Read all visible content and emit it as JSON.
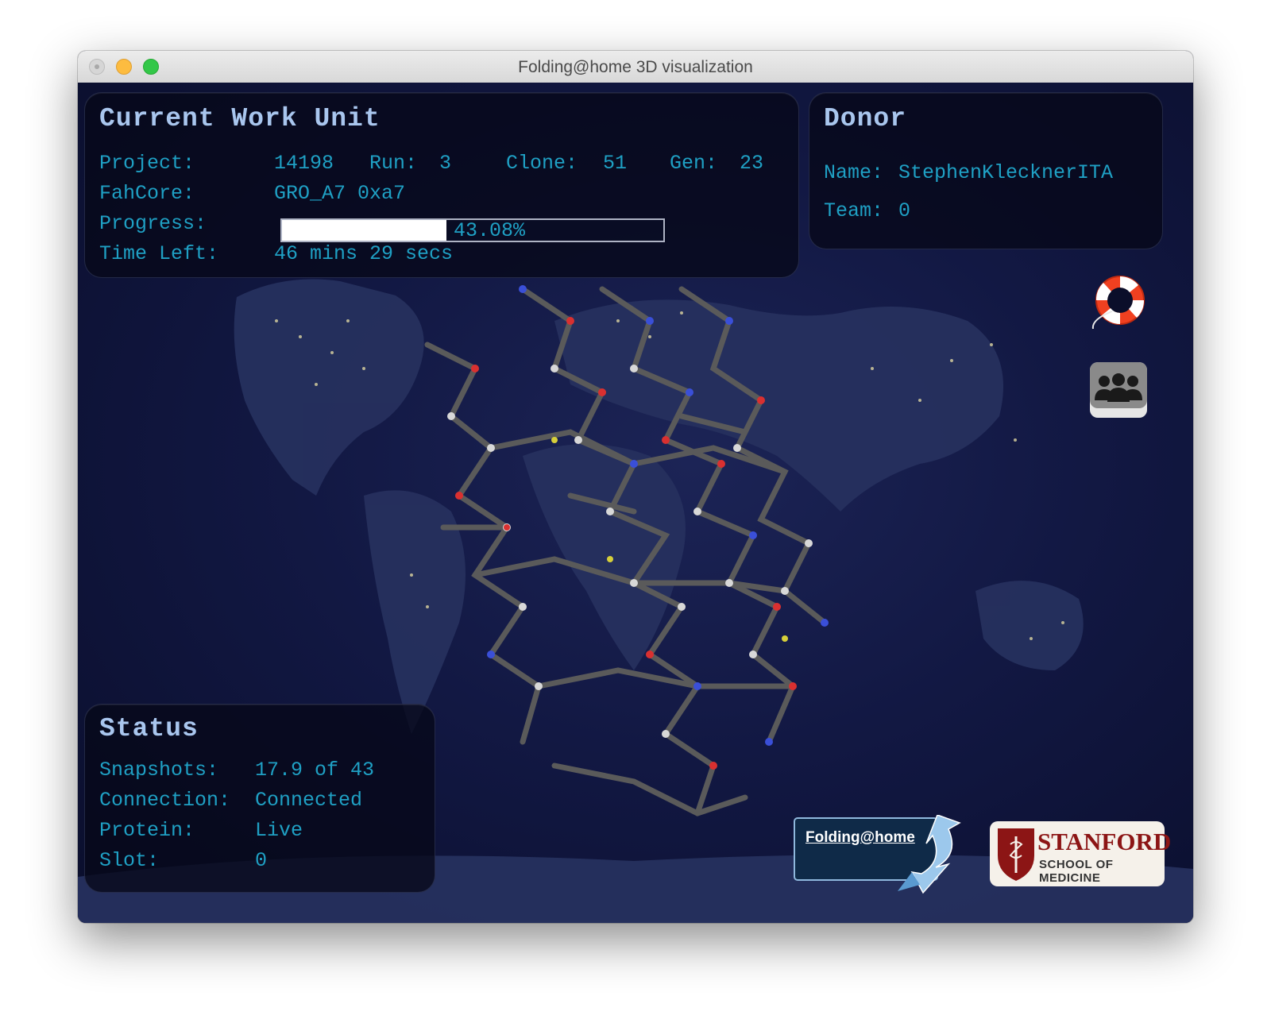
{
  "window": {
    "title": "Folding@home 3D visualization"
  },
  "work_unit": {
    "heading": "Current Work Unit",
    "project_label": "Project:",
    "project_value": "14198",
    "run_label": "Run:",
    "run_value": "3",
    "clone_label": "Clone:",
    "clone_value": "51",
    "gen_label": "Gen:",
    "gen_value": "23",
    "fahcore_label": "FahCore:",
    "fahcore_value": "GRO_A7 0xa7",
    "progress_label": "Progress:",
    "progress_percent": 43.08,
    "progress_text": "43.08%",
    "time_left_label": "Time Left:",
    "time_left_value": "46 mins 29 secs"
  },
  "donor": {
    "heading": "Donor",
    "name_label": "Name:",
    "name_value": "StephenKlecknerITA",
    "team_label": "Team:",
    "team_value": "0"
  },
  "status": {
    "heading": "Status",
    "snapshots_label": "Snapshots:",
    "snapshots_value": "17.9 of 43",
    "connection_label": "Connection:",
    "connection_value": "Connected",
    "protein_label": "Protein:",
    "protein_value": "Live",
    "slot_label": "Slot:",
    "slot_value": "0"
  },
  "buttons": {
    "help_icon": "lifebuoy-icon",
    "team_icon": "people-group-icon"
  },
  "logos": {
    "fah_text": "Folding@home",
    "stanford_name": "STANFORD",
    "stanford_sub": "SCHOOL OF MEDICINE"
  },
  "colors": {
    "panel_text": "#1fa0c4",
    "heading_text": "#a9c6ee",
    "stanford_red": "#8c1515"
  }
}
